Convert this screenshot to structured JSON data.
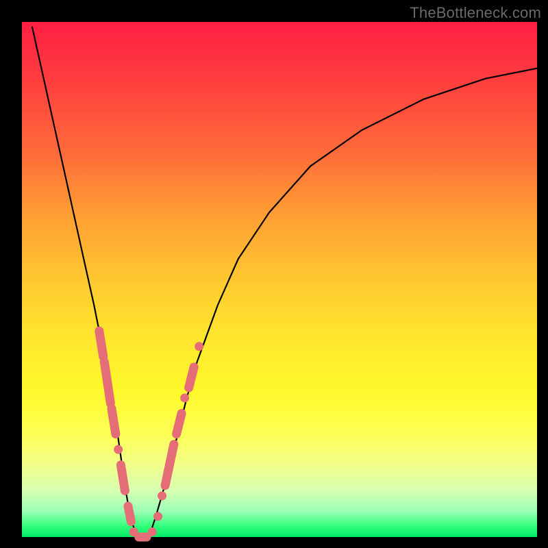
{
  "watermark": "TheBottleneck.com",
  "colors": {
    "marker": "#e46d77",
    "curve": "#000000",
    "background_top": "#ff1f44",
    "background_bottom": "#00e865",
    "frame": "#000000"
  },
  "chart_data": {
    "type": "line",
    "title": "",
    "xlabel": "",
    "ylabel": "",
    "xlim": [
      0,
      100
    ],
    "ylim": [
      0,
      100
    ],
    "grid": false,
    "series": [
      {
        "name": "bottleneck-curve",
        "x": [
          2,
          4,
          6,
          8,
          10,
          12,
          14,
          15,
          16,
          17,
          18,
          19,
          20,
          21,
          22,
          23,
          24,
          25,
          26,
          28,
          30,
          32,
          34,
          38,
          42,
          48,
          56,
          66,
          78,
          90,
          100
        ],
        "y": [
          99,
          90,
          81,
          72,
          63,
          54,
          45,
          40,
          35,
          30,
          24,
          17,
          10,
          4,
          1,
          0,
          0,
          1,
          4,
          11,
          19,
          27,
          34,
          45,
          54,
          63,
          72,
          79,
          85,
          89,
          91
        ]
      }
    ],
    "markers": {
      "segments": [
        {
          "x0": 15.0,
          "y0": 40,
          "x1": 15.8,
          "y1": 35
        },
        {
          "x0": 16.0,
          "y0": 34,
          "x1": 17.2,
          "y1": 26
        },
        {
          "x0": 17.4,
          "y0": 25,
          "x1": 18.2,
          "y1": 20
        },
        {
          "x0": 19.2,
          "y0": 14,
          "x1": 20.0,
          "y1": 9
        },
        {
          "x0": 20.6,
          "y0": 6,
          "x1": 21.2,
          "y1": 3
        },
        {
          "x0": 22.7,
          "y0": 0,
          "x1": 24.2,
          "y1": 0
        },
        {
          "x0": 27.8,
          "y0": 10,
          "x1": 29.5,
          "y1": 18
        },
        {
          "x0": 30.0,
          "y0": 20,
          "x1": 31.0,
          "y1": 24
        },
        {
          "x0": 32.4,
          "y0": 29,
          "x1": 33.4,
          "y1": 33
        }
      ],
      "dots": [
        {
          "x": 18.7,
          "y": 17
        },
        {
          "x": 21.7,
          "y": 1
        },
        {
          "x": 25.3,
          "y": 1
        },
        {
          "x": 26.4,
          "y": 4
        },
        {
          "x": 27.2,
          "y": 8
        },
        {
          "x": 31.6,
          "y": 27
        },
        {
          "x": 34.4,
          "y": 37
        }
      ]
    }
  }
}
